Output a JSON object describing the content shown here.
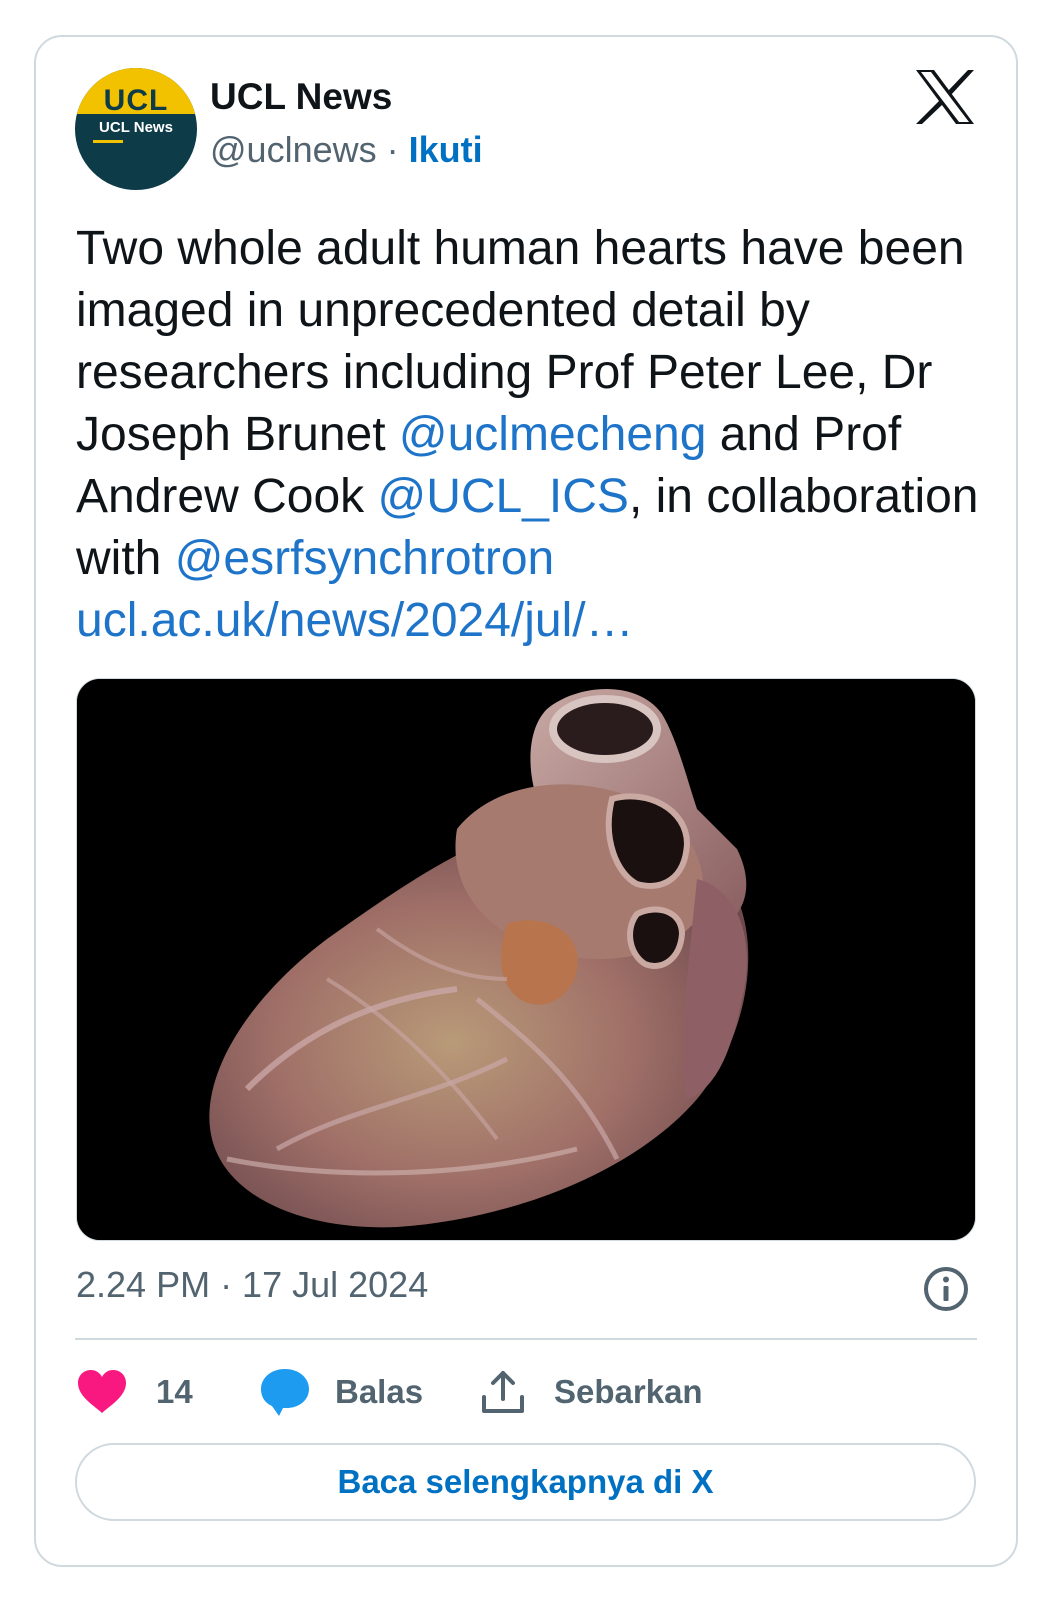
{
  "author": {
    "avatar_logo": "UCL",
    "avatar_subtitle": "UCL News",
    "name": "UCL News",
    "handle": "@uclnews",
    "separator": "·",
    "follow_label": "Ikuti"
  },
  "platform_icon": "x-logo-icon",
  "tweet": {
    "text_parts": [
      {
        "text": "Two whole adult human hearts have been imaged in unprecedented detail by researchers including Prof Peter Lee, Dr Joseph Brunet ",
        "type": "plain"
      },
      {
        "text": "@uclmecheng",
        "type": "link"
      },
      {
        "text": " and Prof Andrew Cook ",
        "type": "plain"
      },
      {
        "text": "@UCL_ICS",
        "type": "link"
      },
      {
        "text": ", in collaboration with ",
        "type": "plain"
      },
      {
        "text": "@esrfsynchrotron",
        "type": "link"
      },
      {
        "text": " ",
        "type": "plain"
      },
      {
        "text": "ucl.ac.uk/news/2024/jul/…",
        "type": "link"
      }
    ],
    "media_description_icon": "human-heart-photo",
    "timestamp": "2.24 PM · 17 Jul 2024"
  },
  "actions": {
    "like_icon": "heart-icon",
    "like_count": "14",
    "reply_icon": "speech-bubble-icon",
    "reply_label": "Balas",
    "share_icon": "share-icon",
    "share_label": "Sebarkan"
  },
  "read_more_label": "Baca selengkapnya di X",
  "colors": {
    "link": "#1d74c9",
    "like": "#f91880",
    "reply": "#1d9bf0",
    "secondary_text": "#536471",
    "border": "#cfd9de",
    "avatar_yellow": "#f2c200",
    "avatar_teal": "#0d3b48"
  }
}
